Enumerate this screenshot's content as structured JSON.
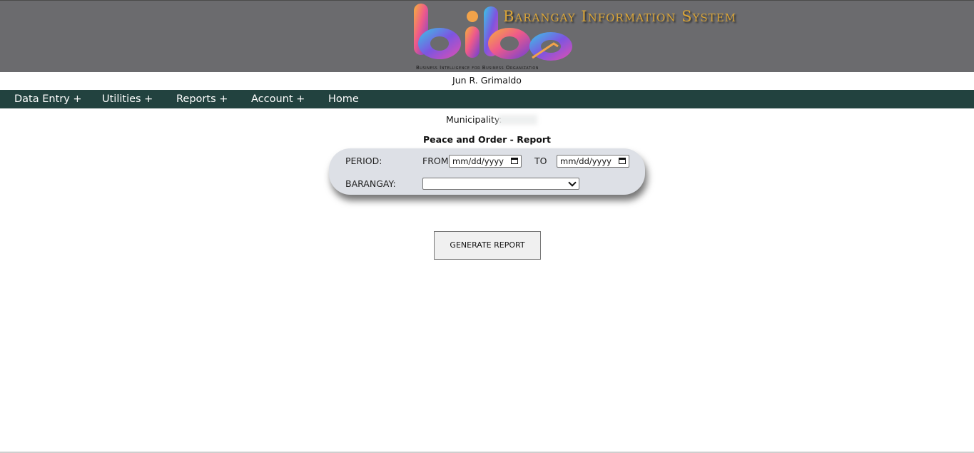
{
  "header": {
    "brand_title": "Barangay Information System",
    "tagline": "Business Intelligence for Business Organization",
    "logo_icon": "bibo-logo-icon",
    "colors": {
      "banner": "#6b6b6e",
      "brand_text": "#d9a437"
    }
  },
  "user": {
    "name": "Jun R. Grimaldo"
  },
  "nav": {
    "background": "#22423f",
    "items": [
      {
        "label": "Data Entry +"
      },
      {
        "label": "Utilities +"
      },
      {
        "label": "Reports +"
      },
      {
        "label": "Account +"
      },
      {
        "label": "Home"
      }
    ]
  },
  "page": {
    "municipality_label": "Municipality:",
    "title": "Peace and Order - Report"
  },
  "form": {
    "period_label": "PERIOD:",
    "from_label": "FROM:",
    "from_value": "mm/dd/yyyy",
    "to_label": "TO",
    "to_value": "mm/dd/yyyy",
    "barangay_label": "BARANGAY:",
    "barangay_value": "",
    "panel_color": "#dde0e6"
  },
  "actions": {
    "generate_label": "GENERATE REPORT"
  }
}
